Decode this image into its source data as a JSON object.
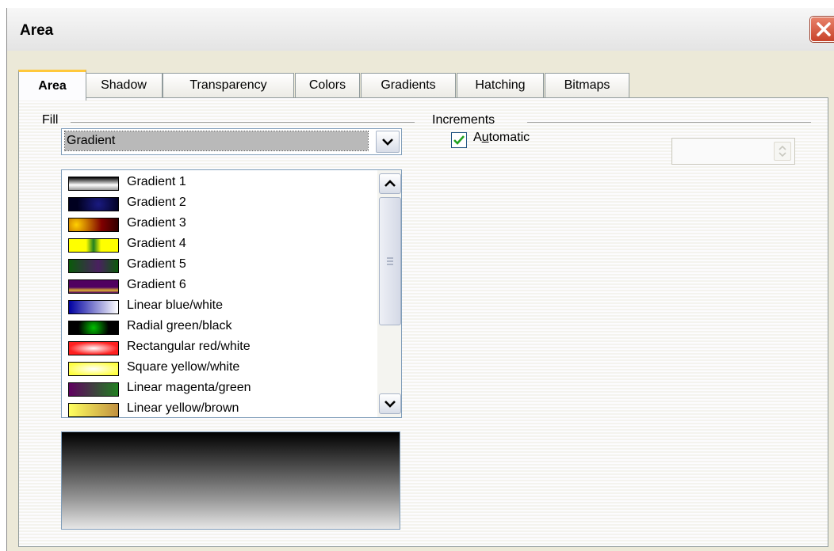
{
  "window": {
    "title": "Area"
  },
  "tabs": [
    "Area",
    "Shadow",
    "Transparency",
    "Colors",
    "Gradients",
    "Hatching",
    "Bitmaps"
  ],
  "fill": {
    "label": "Fill",
    "type": "Gradient",
    "items": [
      "Gradient 1",
      "Gradient 2",
      "Gradient 3",
      "Gradient 4",
      "Gradient 5",
      "Gradient 6",
      "Linear blue/white",
      "Radial green/black",
      "Rectangular red/white",
      "Square yellow/white",
      "Linear magenta/green",
      "Linear yellow/brown"
    ]
  },
  "increments": {
    "label": "Increments",
    "automatic_pre": "A",
    "automatic_accel": "u",
    "automatic_post": "tomatic",
    "automatic_checked": true,
    "value": ""
  }
}
